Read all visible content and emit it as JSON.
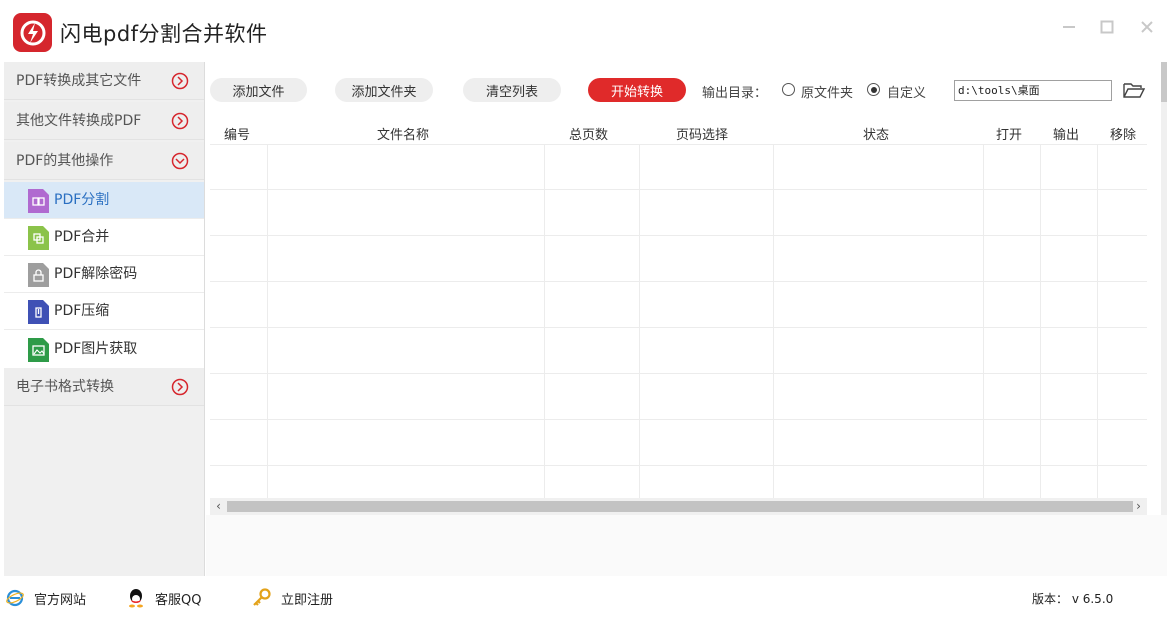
{
  "app": {
    "title": "闪电pdf分割合并软件"
  },
  "sidebar": {
    "categories": [
      {
        "label": "PDF转换成其它文件",
        "state": "collapsed"
      },
      {
        "label": "其他文件转换成PDF",
        "state": "collapsed"
      },
      {
        "label": "PDF的其他操作",
        "state": "expanded"
      },
      {
        "label": "电子书格式转换",
        "state": "collapsed"
      }
    ],
    "sub_items": [
      {
        "label": "PDF分割",
        "icon": "split-file-icon",
        "color": "#b06ad0",
        "active": true
      },
      {
        "label": "PDF合并",
        "icon": "merge-file-icon",
        "color": "#8bc34a",
        "active": false
      },
      {
        "label": "PDF解除密码",
        "icon": "unlock-file-icon",
        "color": "#9e9e9e",
        "active": false
      },
      {
        "label": "PDF压缩",
        "icon": "compress-file-icon",
        "color": "#3f51b5",
        "active": false
      },
      {
        "label": "PDF图片获取",
        "icon": "image-file-icon",
        "color": "#2e9b48",
        "active": false
      }
    ]
  },
  "toolbar": {
    "add_file": "添加文件",
    "add_folder": "添加文件夹",
    "clear_list": "清空列表",
    "start_convert": "开始转换",
    "output_label": "输出目录：",
    "option_original": "原文件夹",
    "option_custom": "自定义",
    "selected_option": "自定义",
    "output_path": "d:\\tools\\桌面"
  },
  "table": {
    "columns": [
      "编号",
      "文件名称",
      "总页数",
      "页码选择",
      "状态",
      "打开",
      "输出",
      "移除"
    ],
    "rows": []
  },
  "footer": {
    "website": "官方网站",
    "support_qq": "客服QQ",
    "register": "立即注册",
    "version": "版本：   v 6.5.0"
  },
  "colors": {
    "accent": "#e02a2a",
    "logo": "#d5262d",
    "active_item_bg": "#d9e8f7",
    "active_item_text": "#2a6fc1"
  }
}
